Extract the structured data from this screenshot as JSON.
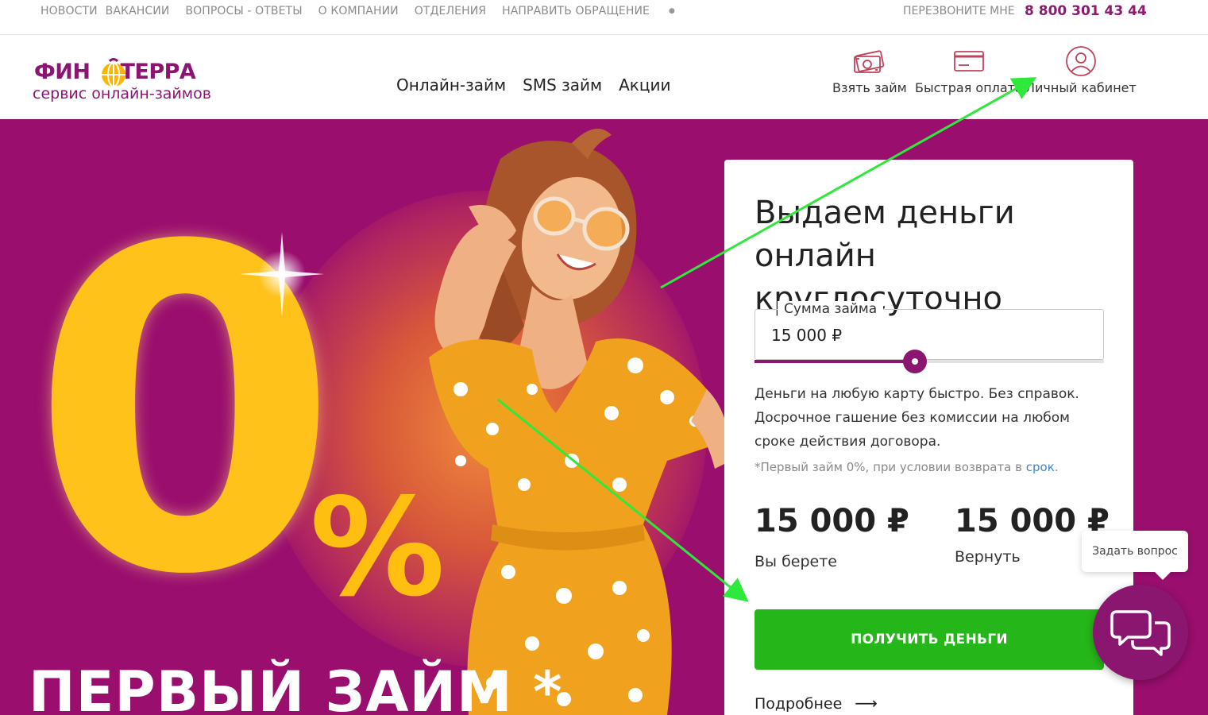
{
  "topbar": {
    "links": [
      "НОВОСТИ",
      "ВАКАНСИИ",
      "ВОПРОСЫ - ОТВЕТЫ",
      "О КОМПАНИИ",
      "ОТДЕЛЕНИЯ",
      "НАПРАВИТЬ ОБРАЩЕНИЕ"
    ],
    "callback": "ПЕРЕЗВОНИТЕ МНЕ",
    "phone": "8 800 301 43 44"
  },
  "brand": {
    "left": "ФИН",
    "right": "ТЕРРА",
    "tagline": "сервис онлайн-займов",
    "color": "#8a1670"
  },
  "mainnav": [
    "Онлайн-займ",
    "SMS займ",
    "Акции"
  ],
  "header_icons": [
    {
      "icon": "money-icon",
      "label": "Взять займ"
    },
    {
      "icon": "card-icon",
      "label": "Быстрая оплата"
    },
    {
      "icon": "user-icon",
      "label": "Личный кабинет"
    }
  ],
  "hero": {
    "big_number": "0",
    "percent": "%",
    "promo": "ПЕРВЫЙ ЗАЙМ *",
    "background": "#9a0e6e",
    "accent": "#ffc21a"
  },
  "card": {
    "title": "Выдаем деньги онлайн круглосуточно",
    "amount_label": "Сумма займа",
    "amount_value": "15 000 ₽",
    "slider_fraction": 0.46,
    "description": "Деньги на любую карту быстро. Без справок. Досрочное гашение без комиссии на любом сроке действия договора.",
    "note_prefix": "*Первый займ 0%, при условии возврата в ",
    "note_link": "срок",
    "note_suffix": ".",
    "take_value": "15 000 ₽",
    "take_label": "Вы берете",
    "return_value": "15 000 ₽",
    "return_label": "Вернуть",
    "cta": "ПОЛУЧИТЬ ДЕНЬГИ",
    "cta_color": "#25b619",
    "more": "Подробнее",
    "more_arrow": "⟶"
  },
  "chat": {
    "tooltip": "Задать вопрос",
    "icon": "chat-bubbles-icon"
  },
  "annotations": {
    "arrow_color": "#2ee83a"
  }
}
